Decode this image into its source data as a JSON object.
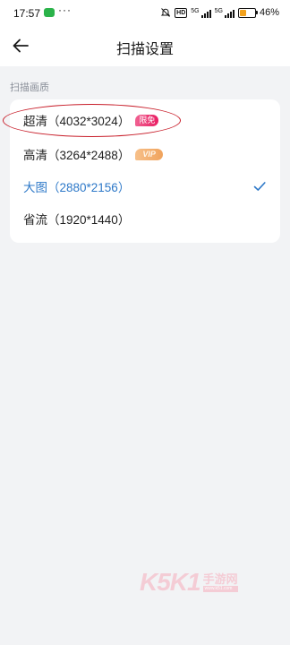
{
  "status_bar": {
    "time": "17:57",
    "dots": "···",
    "hd": "HD",
    "net1": "5G",
    "net2": "5G",
    "battery_level": 46,
    "battery_text": "46%"
  },
  "header": {
    "title": "扫描设置"
  },
  "section": {
    "label": "扫描画质"
  },
  "options": [
    {
      "label": "超清（4032*3024）",
      "badge": "限免",
      "badge_type": "free",
      "selected": false
    },
    {
      "label": "高清（3264*2488）",
      "badge": "VIP",
      "badge_type": "vip",
      "selected": false
    },
    {
      "label": "大图（2880*2156）",
      "badge": "",
      "selected": true
    },
    {
      "label": "省流（1920*1440）",
      "badge": "",
      "selected": false
    }
  ],
  "colors": {
    "accent": "#2d78c8",
    "annotation": "#c81e2a",
    "badge_free": "#e91e63",
    "badge_vip": "#f0a35c"
  },
  "watermark": {
    "brand": "K5K1",
    "text": "手游网",
    "url": "www.k51.com"
  }
}
